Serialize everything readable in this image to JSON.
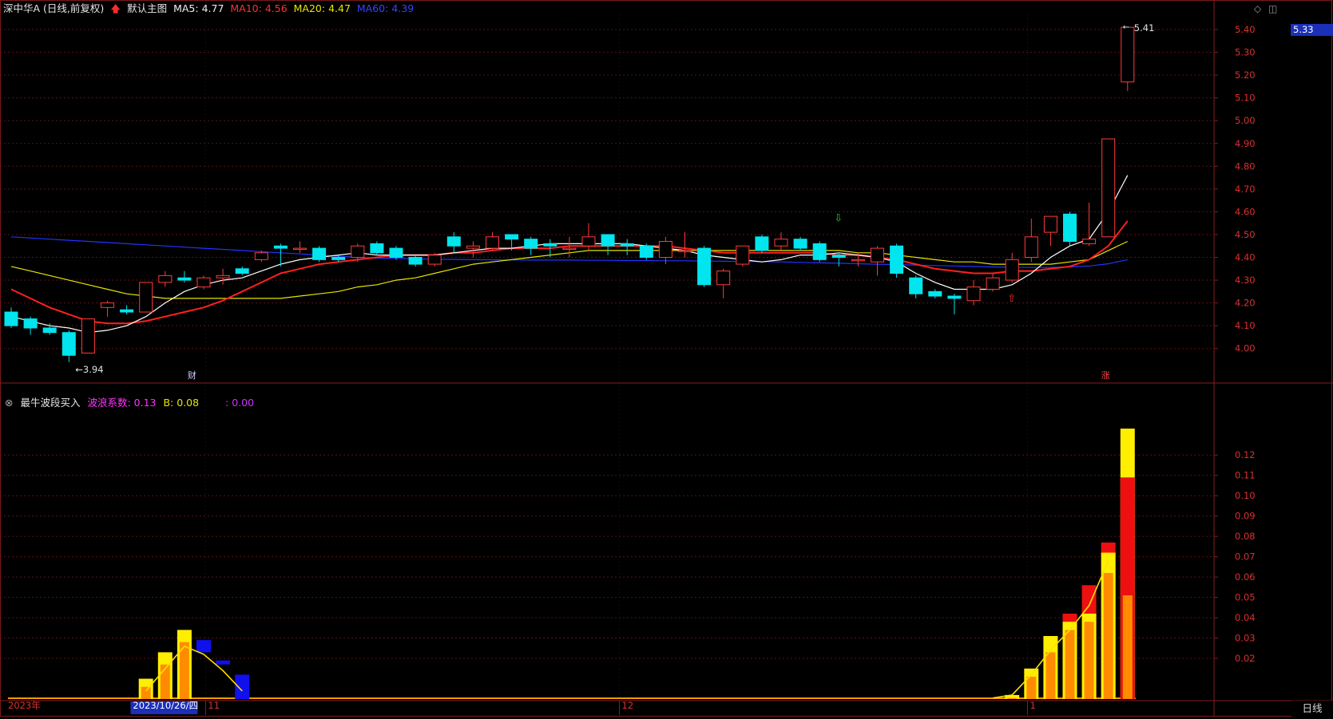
{
  "header": {
    "stock": "深中华A (日线,前复权)",
    "arrow_icon": "red-up-arrow-icon",
    "chart_name": "默认主图",
    "ma5": "MA5: 4.77",
    "ma10": "MA10: 4.56",
    "ma20": "MA20: 4.47",
    "ma60": "MA60: 4.39"
  },
  "indicator_header": {
    "name": "最牛波段买入",
    "coef": "波浪系数: 0.13",
    "b": "B: 0.08",
    "c": ": 0.00"
  },
  "price_axis": [
    "5.40",
    "5.30",
    "5.20",
    "5.10",
    "5.00",
    "4.90",
    "4.80",
    "4.70",
    "4.60",
    "4.50",
    "4.40",
    "4.30",
    "4.20",
    "4.10",
    "4.00"
  ],
  "ind_axis": [
    "0.12",
    "0.11",
    "0.10",
    "0.09",
    "0.08",
    "0.07",
    "0.06",
    "0.05",
    "0.04",
    "0.03",
    "0.02"
  ],
  "last_price": "5.33",
  "high_label": "5.41",
  "low_label": "3.94",
  "markers": {
    "finance": "财",
    "limit_up": "涨"
  },
  "date_axis": {
    "year": "2023年",
    "cursor_date": "2023/10/26/四",
    "m11": "11",
    "m12": "12",
    "m1": "1"
  },
  "period_label": "日线",
  "colors": {
    "up": "#ff3b3b",
    "down": "#00e5ee",
    "ma5": "#ffffff",
    "ma10": "#ff2020",
    "ma20": "#e6e600",
    "ma60": "#2233ff",
    "background": "#000000"
  },
  "chart_data": {
    "type": "candlestick",
    "title": "深中华A (日线,前复权)",
    "price_range": [
      3.92,
      5.45
    ],
    "candles": [
      [
        4.16,
        4.1,
        4.18,
        4.09
      ],
      [
        4.13,
        4.09,
        4.14,
        4.06
      ],
      [
        4.09,
        4.07,
        4.11,
        4.06
      ],
      [
        4.07,
        3.97,
        4.08,
        3.94
      ],
      [
        3.98,
        4.13,
        4.13,
        3.98
      ],
      [
        4.18,
        4.2,
        4.21,
        4.14
      ],
      [
        4.17,
        4.16,
        4.19,
        4.15
      ],
      [
        4.16,
        4.29,
        4.29,
        4.16
      ],
      [
        4.29,
        4.32,
        4.34,
        4.27
      ],
      [
        4.31,
        4.3,
        4.34,
        4.29
      ],
      [
        4.27,
        4.31,
        4.32,
        4.26
      ],
      [
        4.31,
        4.32,
        4.35,
        4.28
      ],
      [
        4.35,
        4.33,
        4.36,
        4.32
      ],
      [
        4.39,
        4.42,
        4.43,
        4.38
      ],
      [
        4.45,
        4.44,
        4.46,
        4.36
      ],
      [
        4.44,
        4.44,
        4.47,
        4.42
      ],
      [
        4.44,
        4.39,
        4.45,
        4.38
      ],
      [
        4.4,
        4.39,
        4.41,
        4.38
      ],
      [
        4.4,
        4.45,
        4.46,
        4.38
      ],
      [
        4.46,
        4.42,
        4.47,
        4.41
      ],
      [
        4.44,
        4.4,
        4.45,
        4.39
      ],
      [
        4.4,
        4.37,
        4.41,
        4.36
      ],
      [
        4.37,
        4.41,
        4.42,
        4.36
      ],
      [
        4.49,
        4.45,
        4.51,
        4.42
      ],
      [
        4.44,
        4.45,
        4.47,
        4.4
      ],
      [
        4.44,
        4.49,
        4.51,
        4.43
      ],
      [
        4.5,
        4.48,
        4.5,
        4.43
      ],
      [
        4.48,
        4.44,
        4.49,
        4.41
      ],
      [
        4.46,
        4.45,
        4.48,
        4.4
      ],
      [
        4.44,
        4.44,
        4.49,
        4.4
      ],
      [
        4.45,
        4.49,
        4.55,
        4.43
      ],
      [
        4.5,
        4.45,
        4.5,
        4.41
      ],
      [
        4.46,
        4.45,
        4.48,
        4.41
      ],
      [
        4.45,
        4.4,
        4.46,
        4.39
      ],
      [
        4.4,
        4.47,
        4.49,
        4.37
      ],
      [
        4.43,
        4.43,
        4.51,
        4.4
      ],
      [
        4.44,
        4.28,
        4.45,
        4.27
      ],
      [
        4.28,
        4.34,
        4.35,
        4.22
      ],
      [
        4.37,
        4.45,
        4.45,
        4.36
      ],
      [
        4.49,
        4.43,
        4.5,
        4.42
      ],
      [
        4.45,
        4.48,
        4.51,
        4.43
      ],
      [
        4.48,
        4.44,
        4.49,
        4.43
      ],
      [
        4.46,
        4.39,
        4.47,
        4.38
      ],
      [
        4.41,
        4.4,
        4.42,
        4.36
      ],
      [
        4.39,
        4.39,
        4.42,
        4.36
      ],
      [
        4.38,
        4.44,
        4.45,
        4.32
      ],
      [
        4.45,
        4.33,
        4.46,
        4.31
      ],
      [
        4.31,
        4.24,
        4.32,
        4.22
      ],
      [
        4.25,
        4.23,
        4.26,
        4.22
      ],
      [
        4.23,
        4.22,
        4.24,
        4.15
      ],
      [
        4.21,
        4.27,
        4.3,
        4.19
      ],
      [
        4.26,
        4.31,
        4.33,
        4.25
      ],
      [
        4.3,
        4.39,
        4.42,
        4.29
      ],
      [
        4.4,
        4.49,
        4.57,
        4.38
      ],
      [
        4.51,
        4.58,
        4.58,
        4.45
      ],
      [
        4.59,
        4.47,
        4.6,
        4.45
      ],
      [
        4.46,
        4.48,
        4.64,
        4.45
      ],
      [
        4.49,
        4.92,
        4.92,
        4.49
      ],
      [
        5.17,
        5.41,
        5.41,
        5.13
      ]
    ],
    "ma5": [
      4.14,
      4.12,
      4.1,
      4.09,
      4.07,
      4.08,
      4.1,
      4.14,
      4.2,
      4.25,
      4.28,
      4.3,
      4.31,
      4.34,
      4.37,
      4.39,
      4.4,
      4.41,
      4.42,
      4.41,
      4.41,
      4.41,
      4.41,
      4.42,
      4.43,
      4.44,
      4.44,
      4.45,
      4.46,
      4.46,
      4.46,
      4.46,
      4.46,
      4.45,
      4.44,
      4.43,
      4.41,
      4.4,
      4.39,
      4.38,
      4.39,
      4.41,
      4.41,
      4.42,
      4.41,
      4.4,
      4.38,
      4.33,
      4.29,
      4.26,
      4.26,
      4.26,
      4.28,
      4.33,
      4.4,
      4.45,
      4.48,
      4.6,
      4.76
    ],
    "ma10": [
      4.26,
      4.22,
      4.18,
      4.15,
      4.12,
      4.11,
      4.11,
      4.12,
      4.14,
      4.16,
      4.18,
      4.21,
      4.25,
      4.29,
      4.33,
      4.35,
      4.37,
      4.38,
      4.39,
      4.4,
      4.41,
      4.41,
      4.41,
      4.42,
      4.42,
      4.43,
      4.44,
      4.44,
      4.44,
      4.45,
      4.45,
      4.45,
      4.45,
      4.45,
      4.45,
      4.44,
      4.43,
      4.42,
      4.42,
      4.42,
      4.42,
      4.42,
      4.42,
      4.41,
      4.41,
      4.4,
      4.39,
      4.37,
      4.35,
      4.34,
      4.33,
      4.33,
      4.34,
      4.34,
      4.35,
      4.36,
      4.39,
      4.45,
      4.56
    ],
    "ma20": [
      4.36,
      4.34,
      4.32,
      4.3,
      4.28,
      4.26,
      4.24,
      4.23,
      4.22,
      4.22,
      4.22,
      4.22,
      4.22,
      4.22,
      4.22,
      4.23,
      4.24,
      4.25,
      4.27,
      4.28,
      4.3,
      4.31,
      4.33,
      4.35,
      4.37,
      4.38,
      4.39,
      4.4,
      4.41,
      4.42,
      4.43,
      4.43,
      4.43,
      4.43,
      4.43,
      4.43,
      4.43,
      4.43,
      4.43,
      4.43,
      4.43,
      4.43,
      4.43,
      4.43,
      4.42,
      4.42,
      4.41,
      4.4,
      4.39,
      4.38,
      4.38,
      4.37,
      4.37,
      4.37,
      4.37,
      4.38,
      4.39,
      4.43,
      4.47
    ],
    "ma60": [
      4.49,
      4.485,
      4.48,
      4.475,
      4.47,
      4.465,
      4.46,
      4.455,
      4.45,
      4.445,
      4.44,
      4.435,
      4.43,
      4.425,
      4.42,
      4.415,
      4.41,
      4.405,
      4.4,
      4.397,
      4.395,
      4.393,
      4.392,
      4.391,
      4.39,
      4.389,
      4.389,
      4.388,
      4.388,
      4.388,
      4.387,
      4.387,
      4.386,
      4.386,
      4.385,
      4.385,
      4.384,
      4.383,
      4.382,
      4.381,
      4.38,
      4.378,
      4.376,
      4.374,
      4.372,
      4.37,
      4.368,
      4.366,
      4.364,
      4.362,
      4.36,
      4.358,
      4.357,
      4.356,
      4.356,
      4.358,
      4.362,
      4.372,
      4.39
    ],
    "indicator": {
      "name": "最牛波段买入",
      "range": [
        0,
        0.132
      ],
      "bars": [
        {
          "i": 7,
          "orange": 0.006,
          "yellow": 0.01
        },
        {
          "i": 8,
          "orange": 0.017,
          "yellow": 0.023
        },
        {
          "i": 9,
          "orange": 0.028,
          "yellow": 0.034
        },
        {
          "i": 10,
          "blue_top": 0.029,
          "blue_bot": 0.023
        },
        {
          "i": 11,
          "blue_top": 0.019,
          "blue_bot": 0.017
        },
        {
          "i": 12,
          "blue_top": 0.012,
          "blue_bot": 0.0
        },
        {
          "i": 52,
          "orange": 0.0005,
          "yellow": 0.002
        },
        {
          "i": 53,
          "orange": 0.011,
          "yellow": 0.015
        },
        {
          "i": 54,
          "orange": 0.023,
          "yellow": 0.031
        },
        {
          "i": 55,
          "orange": 0.034,
          "yellow": 0.038,
          "red": 0.042
        },
        {
          "i": 56,
          "orange": 0.038,
          "yellow": 0.042,
          "red": 0.056
        },
        {
          "i": 57,
          "orange": 0.062,
          "yellow": 0.072,
          "red": 0.077
        },
        {
          "i": 58,
          "orange": 0.051,
          "red": 0.109,
          "yellow": 0.133
        }
      ],
      "line": [
        [
          7,
          0.004
        ],
        [
          8,
          0.015
        ],
        [
          9,
          0.026
        ],
        [
          10,
          0.022
        ],
        [
          11,
          0.014
        ],
        [
          12,
          0.004
        ],
        [
          51,
          0.0005
        ],
        [
          52,
          0.002
        ],
        [
          53,
          0.012
        ],
        [
          54,
          0.024
        ],
        [
          55,
          0.034
        ],
        [
          56,
          0.046
        ],
        [
          57,
          0.068
        ]
      ]
    }
  }
}
